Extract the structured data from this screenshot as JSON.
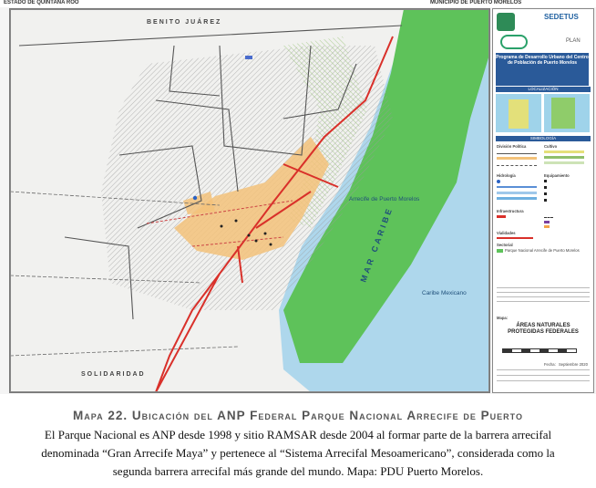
{
  "map": {
    "header_left": "ESTADO DE QUINTANA ROO",
    "header_right": "MUNICIPIO DE PUERTO MORELOS",
    "labels": {
      "benito_juarez": "BENITO JUÁREZ",
      "solidaridad": "SOLIDARIDAD",
      "arrecife": "Arrecife de Puerto Morelos",
      "mar_caribe": "MAR CARIBE",
      "caribe_mexicano": "Caribe Mexicano"
    },
    "colors": {
      "anp_green": "#5ec25a",
      "sea_blue": "#aed7ec",
      "urban_orange": "#f3c27a",
      "road_red": "#d9302a",
      "limit_dark": "#555555"
    }
  },
  "panel": {
    "logo_text": "SEDETUS",
    "logo_sub": "PLAN",
    "program_title": "Programa de Desarrollo Urbano del Centro de Población de Puerto Morelos",
    "localizacion": "LOCALIZACIÓN",
    "simbologia": "SIMBOLOGÍA",
    "legend_headers": [
      "División Política",
      "Hidrología",
      "Infraestructura",
      "Vialidades",
      "Sectorial"
    ],
    "legend_items_right_headers": [
      "Cultivo",
      "Equipamiento"
    ],
    "sectorial_item": "Parque Nacional Arrecife de Puerto Morelos",
    "mapa_label": "Mapa:",
    "mapa_title": "ÁREAS NATURALES PROTEGIDAS FEDERALES",
    "fecha_label": "Fecha:",
    "fecha_value": "Septiembre 2020"
  },
  "caption": {
    "title": "Mapa 22. Ubicación del ANP Federal Parque Nacional Arrecife de Puerto",
    "body": "El Parque Nacional es ANP desde 1998 y sitio RAMSAR desde 2004 al formar parte de la barrera arrecifal denominada “Gran Arrecife Maya” y pertenece al “Sistema Arrecifal Mesoamericano”, considerada como la segunda barrera arrecifal más grande del mundo. Mapa: PDU Puerto Morelos."
  }
}
